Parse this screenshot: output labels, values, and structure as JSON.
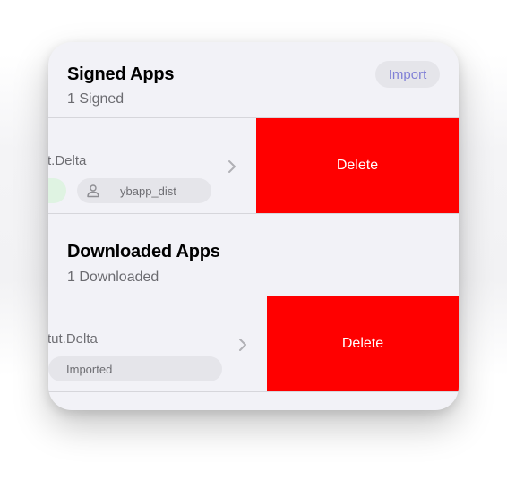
{
  "signed": {
    "title": "Signed Apps",
    "subtitle": "1 Signed",
    "import_label": "Import",
    "rows": [
      {
        "name": "t.Delta",
        "user_label": "ybapp_dist",
        "delete_label": "Delete"
      }
    ]
  },
  "downloaded": {
    "title": "Downloaded Apps",
    "subtitle": "1 Downloaded",
    "rows": [
      {
        "name": "tut.Delta",
        "status_label": "Imported",
        "delete_label": "Delete"
      }
    ]
  },
  "colors": {
    "accent": "#7f7fd6",
    "delete": "#ff0000",
    "background": "#f2f2f7",
    "chip": "#e5e5ea",
    "signed_chip": "#dff3e2"
  },
  "icons": {
    "chevron": "chevron-right-icon",
    "user": "person-icon"
  }
}
